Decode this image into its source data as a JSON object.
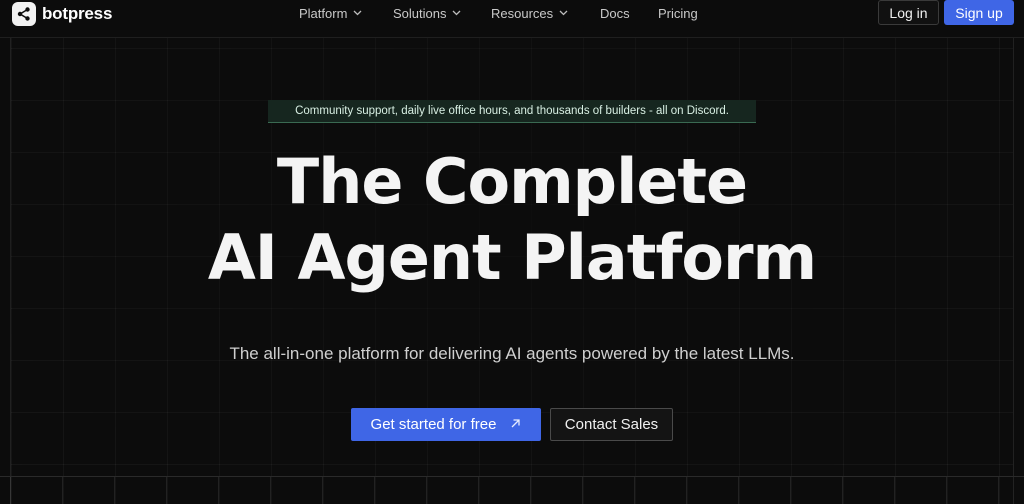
{
  "brand": {
    "name": "botpress",
    "icon": "botpress-share-logo-icon"
  },
  "nav": {
    "items": [
      {
        "label": "Platform",
        "has_dropdown": true
      },
      {
        "label": "Solutions",
        "has_dropdown": true
      },
      {
        "label": "Resources",
        "has_dropdown": true
      },
      {
        "label": "Docs",
        "has_dropdown": false
      },
      {
        "label": "Pricing",
        "has_dropdown": false
      }
    ],
    "login_label": "Log in",
    "signup_label": "Sign up"
  },
  "hero": {
    "badge": "Community support, daily live office hours, and thousands of builders - all on Discord.",
    "headline_line1": "The Complete",
    "headline_line2": "AI Agent Platform",
    "subtitle": "The all-in-one platform for delivering AI agents powered by the latest LLMs.",
    "cta_primary": "Get started for free",
    "cta_primary_icon": "arrow-up-right-icon",
    "cta_secondary": "Contact Sales"
  },
  "colors": {
    "background": "#0c0c0c",
    "accent": "#3f66e6",
    "badge_bg": "#16261f",
    "badge_border": "#3a6a52"
  }
}
